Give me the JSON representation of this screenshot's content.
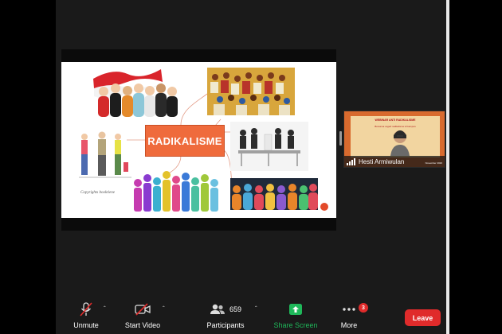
{
  "slide": {
    "center_title": "RADIKALISME",
    "caption": "Copyrights booktiene"
  },
  "participant_tile": {
    "title": "WEBINAR ANTI RADIKALISME",
    "subtitle": "Bersama cegah radikalisme di kampus",
    "name": "Hesti Armiwulan",
    "date": "November 2020"
  },
  "toolbar": {
    "unmute_label": "Unmute",
    "start_video_label": "Start Video",
    "participants_label": "Participants",
    "participants_count": "659",
    "share_screen_label": "Share Screen",
    "more_label": "More",
    "more_badge": "3",
    "leave_label": "Leave"
  },
  "colors": {
    "share_green": "#1fb85a",
    "leave_red": "#e02b2b",
    "accent_orange": "#ef6b3c"
  }
}
